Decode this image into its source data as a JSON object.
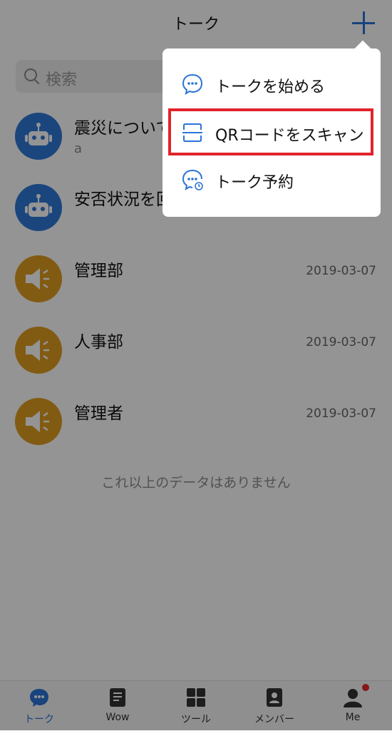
{
  "header": {
    "title": "トーク",
    "add_icon": "plus-icon",
    "accent": "#2b74d6"
  },
  "search": {
    "placeholder": "検索"
  },
  "chats": [
    {
      "name": "震災について",
      "sub": "a",
      "date": "",
      "avatar": "robot-icon"
    },
    {
      "name": "安否状況を回",
      "sub": "",
      "date": "",
      "avatar": "robot-icon"
    },
    {
      "name": "管理部",
      "sub": "",
      "date": "2019-03-07",
      "avatar": "speaker-icon"
    },
    {
      "name": "人事部",
      "sub": "",
      "date": "2019-03-07",
      "avatar": "speaker-icon"
    },
    {
      "name": "管理者",
      "sub": "",
      "date": "2019-03-07",
      "avatar": "speaker-icon"
    }
  ],
  "list_end": "これ以上のデータはありません",
  "menu": {
    "items": [
      {
        "label": "トークを始める",
        "icon": "chat-bubble-icon"
      },
      {
        "label": "QRコードをスキャン",
        "icon": "scan-icon"
      },
      {
        "label": "トーク予約",
        "icon": "chat-schedule-icon"
      }
    ],
    "highlight_color": "#e2232b"
  },
  "nav": [
    {
      "label": "トーク",
      "icon": "chat-icon",
      "active": true
    },
    {
      "label": "Wow",
      "icon": "notes-icon",
      "active": false
    },
    {
      "label": "ツール",
      "icon": "grid-icon",
      "active": false
    },
    {
      "label": "メンバー",
      "icon": "contacts-icon",
      "active": false
    },
    {
      "label": "Me",
      "icon": "person-icon",
      "active": false
    }
  ]
}
